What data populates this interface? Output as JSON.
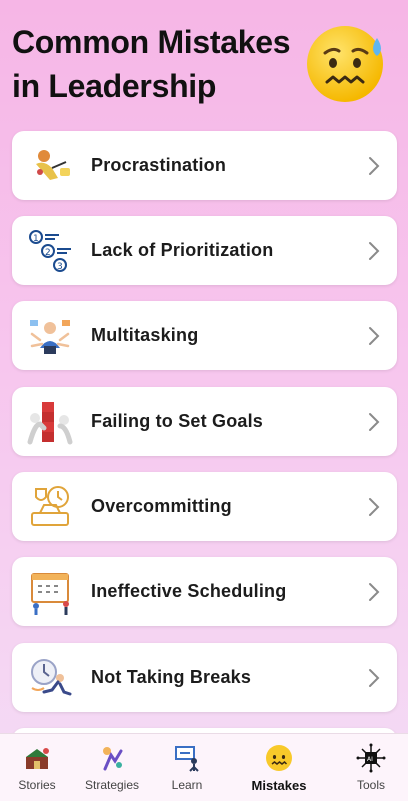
{
  "header": {
    "title": "Common Mistakes in Leadership",
    "emoji_icon": "anxious-face-icon"
  },
  "colors": {
    "background_top": "#f6b6e6",
    "card": "#ffffff",
    "text": "#1c1c1c",
    "chevron": "#8a8a8a",
    "tabbar": "#fdf4fb"
  },
  "mistakes": [
    {
      "label": "Procrastination",
      "icon": "procrastination-illustration-icon"
    },
    {
      "label": "Lack of Prioritization",
      "icon": "numbered-priority-list-icon"
    },
    {
      "label": "Multitasking",
      "icon": "multitasking-person-icon"
    },
    {
      "label": "Failing to Set Goals",
      "icon": "goal-blocks-icon"
    },
    {
      "label": "Overcommitting",
      "icon": "clock-and-award-icon"
    },
    {
      "label": "Ineffective Scheduling",
      "icon": "calendar-scheduling-icon"
    },
    {
      "label": "Not Taking Breaks",
      "icon": "clock-running-person-icon"
    }
  ],
  "tabs": [
    {
      "label": "Stories",
      "icon": "stories-icon",
      "active": false
    },
    {
      "label": "Strategies",
      "icon": "strategies-icon",
      "active": false
    },
    {
      "label": "Learn",
      "icon": "learn-icon",
      "active": false
    },
    {
      "label": "Mistakes",
      "icon": "anxious-face-icon",
      "active": true
    },
    {
      "label": "Tools",
      "icon": "tools-icon",
      "active": false
    }
  ]
}
